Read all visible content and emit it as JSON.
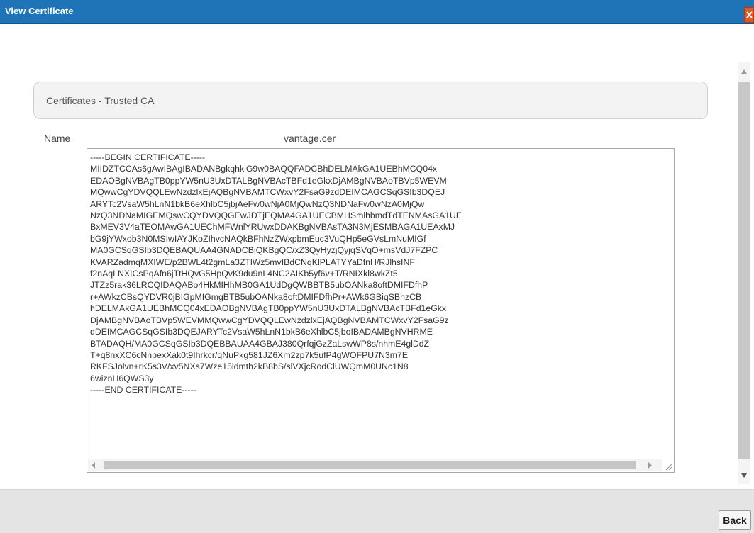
{
  "window": {
    "title": "View Certificate",
    "close_label": "X",
    "title_bar_color": "#1e74b6"
  },
  "section": {
    "title": "Certificates - Trusted CA"
  },
  "form": {
    "name_label": "Name",
    "name_value": "vantage.cer"
  },
  "certificate": {
    "lines": [
      "-----BEGIN CERTIFICATE-----",
      "MIIDZTCCAs6gAwIBAgIBADANBgkqhkiG9w0BAQQFADCBhDELMAkGA1UEBhMCQ04x",
      "EDAOBgNVBAgTB0ppYW5nU3UxDTALBgNVBAcTBFd1eGkxDjAMBgNVBAoTBVp5WEVM",
      "MQwwCgYDVQQLEwNzdzlxEjAQBgNVBAMTCWxvY2FsaG9zdDEIMCAGCSqGSIb3DQEJ",
      "ARYTc2VsaW5hLnN1bkB6eXhlbC5jbjAeFw0wNjA0MjQwNzQ3NDNaFw0wNzA0MjQw",
      "NzQ3NDNaMIGEMQswCQYDVQQGEwJDTjEQMA4GA1UECBMHSmlhbmdTdTENMAsGA1UE",
      "BxMEV3V4aTEOMAwGA1UEChMFWnlYRUwxDDAKBgNVBAsTA3N3MjESMBAGA1UEAxMJ",
      "bG9jYWxob3N0MSIwIAYJKoZIhvcNAQkBFhNzZWxpbmEuc3VuQHp5eGVsLmNuMIGf",
      "MA0GCSqGSIb3DQEBAQUAA4GNADCBiQKBgQC/xZ3QyHyzjQyjqSVqO+msVdJ7FZPC",
      "KVARZadmqMXIWE/p2BWL4t2gmLa3ZTlWz5mvIBdCNqKlPLATYYaDfnH/RJlhsINF",
      "f2nAqLNXICsPqAfn6jTtHQvG5HpQvK9du9nL4NC2AIKb5yf6v+T/RNIXkl8wkZt5",
      "JTZz5rak36LRCQIDAQABo4HkMIHhMB0GA1UdDgQWBBTB5ubOANka8oftDMIFDfhP",
      "r+AWkzCBsQYDVR0jBIGpMIGmgBTB5ubOANka8oftDMIFDfhPr+AWk6GBiqSBhzCB",
      "hDELMAkGA1UEBhMCQ04xEDAOBgNVBAgTB0ppYW5nU3UxDTALBgNVBAcTBFd1eGkx",
      "DjAMBgNVBAoTBVp5WEVMMQwwCgYDVQQLEwNzdzlxEjAQBgNVBAMTCWxvY2FsaG9z",
      "dDEIMCAGCSqGSIb3DQEJARYTc2VsaW5hLnN1bkB6eXhlbC5jboIBADAMBgNVHRME",
      "BTADAQH/MA0GCSqGSIb3DQEBBAUAA4GBAJ380QrfqjGzZaLswWP8s/nhmE4glDdZ",
      "T+q8nxXC6cNnpexXak0t9Ihrkcr/qNuPkg581JZ6Xm2zp7k5ufP4gWOFPU7N3m7E",
      "RKFSJolvn+rK5s3V/xv5NXs7Wze15ldmth2kB8bS/slVXjcRodClUWQmM0UNc1N8",
      "6wiznH6QWS3y",
      "-----END CERTIFICATE-----"
    ]
  },
  "footer": {
    "back_label": "Back"
  }
}
